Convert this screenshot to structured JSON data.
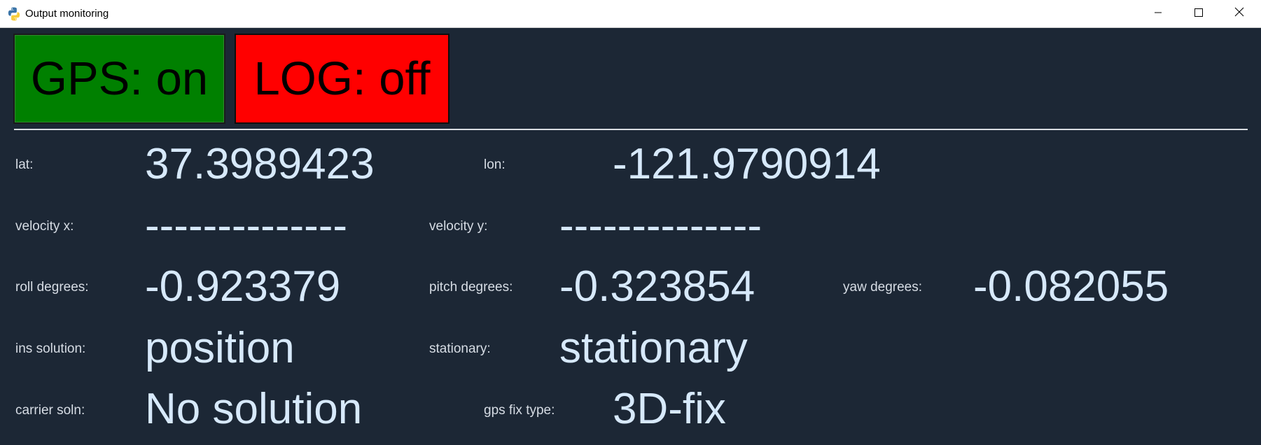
{
  "window": {
    "title": "Output monitoring",
    "app_icon": "python-icon",
    "controls": {
      "minimize": "minimize-icon",
      "maximize": "maximize-icon",
      "close": "close-icon"
    }
  },
  "toggles": {
    "gps_label": "GPS: on",
    "log_label": "LOG: off",
    "gps_color": "#008000",
    "log_color": "#ff0000"
  },
  "fields": {
    "lat": {
      "label": "lat:",
      "value": "37.3989423"
    },
    "lon": {
      "label": "lon:",
      "value": "-121.9790914"
    },
    "velocity_x": {
      "label": "velocity x:",
      "value": "--------------"
    },
    "velocity_y": {
      "label": "velocity y:",
      "value": "--------------"
    },
    "roll": {
      "label": "roll degrees:",
      "value": "-0.923379"
    },
    "pitch": {
      "label": "pitch degrees:",
      "value": "-0.323854"
    },
    "yaw": {
      "label": "yaw degrees:",
      "value": "-0.082055"
    },
    "ins_solution": {
      "label": "ins solution:",
      "value": "position"
    },
    "stationary": {
      "label": "stationary:",
      "value": "stationary"
    },
    "carrier_soln": {
      "label": "carrier soln:",
      "value": "No solution"
    },
    "gps_fix_type": {
      "label": "gps fix type:",
      "value": "3D-fix"
    }
  },
  "colors": {
    "background": "#1c2735",
    "label": "#d6dce4",
    "value": "#d7e9fb"
  }
}
